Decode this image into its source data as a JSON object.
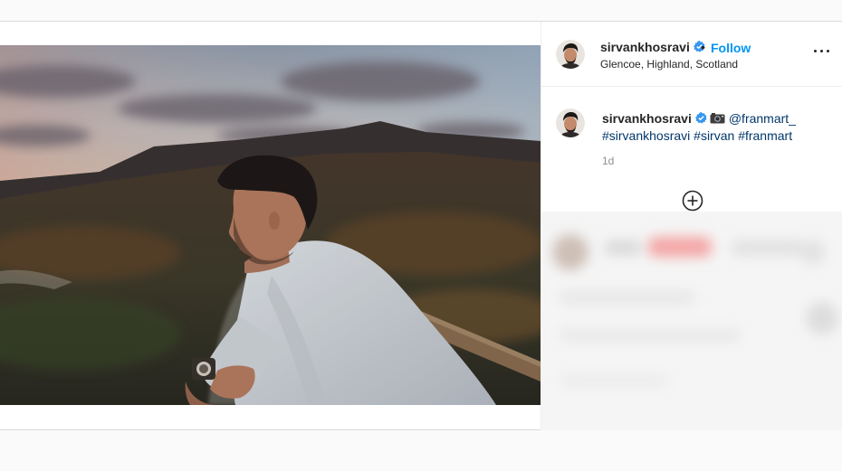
{
  "post": {
    "username": "sirvankhosravi",
    "verified": true,
    "follow_label": "Follow",
    "separator": "•",
    "location": "Glencoe, Highland, Scotland",
    "caption": {
      "username": "sirvankhosravi",
      "mention": "@franmart_",
      "hashtags": [
        "#sirvankhosravi",
        "#sirvan",
        "#franmart"
      ],
      "camera_icon": "camera-emoji-icon"
    },
    "time_ago": "1d",
    "icons": {
      "more": "more-options-icon",
      "add_comment": "plus-circle-icon",
      "verified": "verified-badge-icon"
    },
    "colors": {
      "follow_blue": "#0095f6",
      "link_blue": "#00376b",
      "verified_blue": "#3897f0",
      "meta_gray": "#8e8e8e"
    }
  }
}
